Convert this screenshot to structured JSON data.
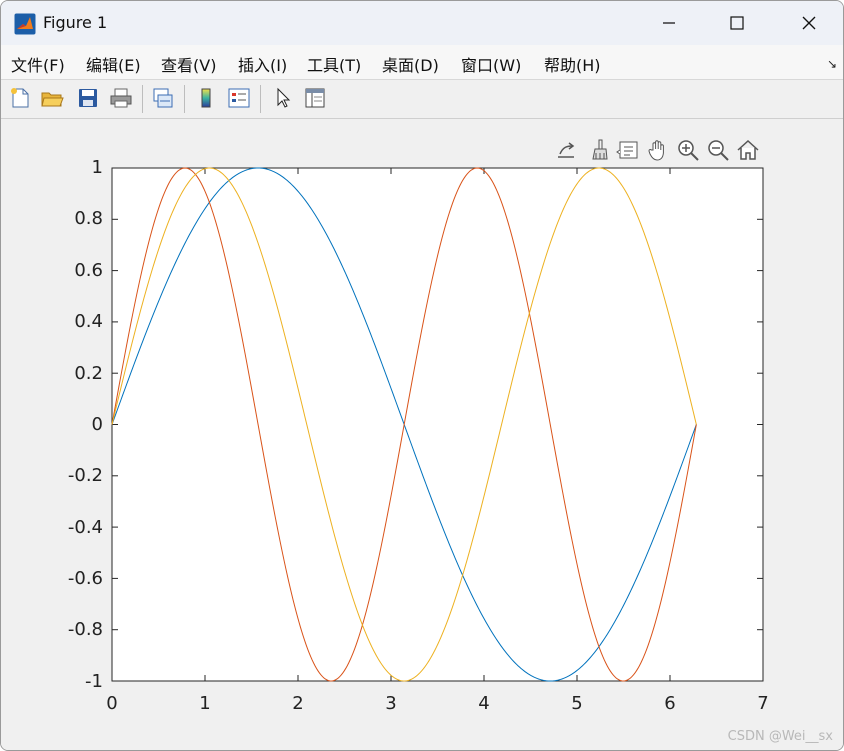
{
  "window": {
    "title": "Figure 1"
  },
  "menu": {
    "items": [
      "文件(F)",
      "编辑(E)",
      "查看(V)",
      "插入(I)",
      "工具(T)",
      "桌面(D)",
      "窗口(W)",
      "帮助(H)"
    ],
    "dock_arrow": "↘"
  },
  "toolbar": {
    "buttons": [
      "new-figure-icon",
      "open-file-icon",
      "save-icon",
      "print-icon",
      "link-plot-icon",
      "insert-colorbar-icon",
      "insert-legend-icon",
      "edit-plot-icon",
      "property-inspector-icon"
    ]
  },
  "axes_toolbar": {
    "buttons": [
      "export-icon",
      "brush-icon",
      "data-tips-icon",
      "pan-icon",
      "zoom-in-icon",
      "zoom-out-icon",
      "home-icon"
    ]
  },
  "chart_data": {
    "type": "line",
    "title": "",
    "xlabel": "",
    "ylabel": "",
    "xlim": [
      0,
      7
    ],
    "ylim": [
      -1,
      1
    ],
    "xticks": [
      "0",
      "1",
      "2",
      "3",
      "4",
      "5",
      "6",
      "7"
    ],
    "yticks": [
      "1",
      "0.8",
      "0.6",
      "0.4",
      "0.2",
      "0",
      "-0.2",
      "-0.4",
      "-0.6",
      "-0.8",
      "-1"
    ],
    "grid": false,
    "legend": "none",
    "x_range": [
      0,
      6.2832
    ],
    "series": [
      {
        "function": "sin(x)",
        "color": "#0072BD"
      },
      {
        "function": "sin(2x)",
        "color": "#D95319"
      },
      {
        "function": "sin(1.5x)",
        "color": "#EDB120"
      }
    ]
  },
  "watermark": "CSDN @Wei__sx"
}
